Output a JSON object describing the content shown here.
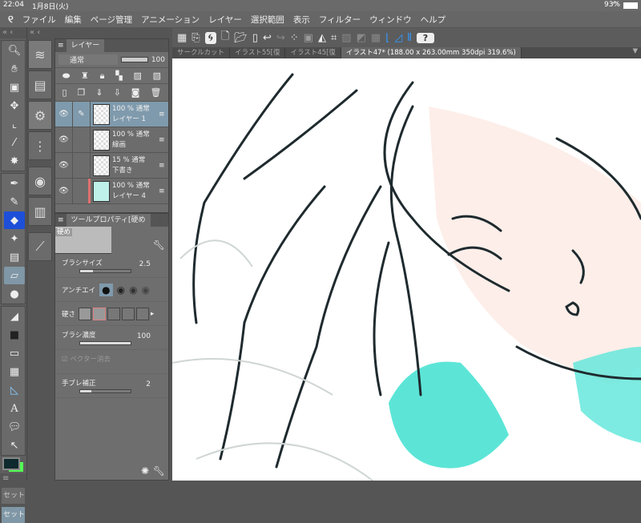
{
  "status": {
    "time": "22:04",
    "date": "1月8日(火)",
    "battery": "93%"
  },
  "menu": [
    "ファイル",
    "編集",
    "ページ管理",
    "アニメーション",
    "レイヤー",
    "選択範囲",
    "表示",
    "フィルター",
    "ウィンドウ",
    "ヘルプ"
  ],
  "layer_panel": {
    "tab": "レイヤー",
    "blend_mode": "通常",
    "opacity": "100",
    "layers": [
      {
        "line1": "100 % 通常",
        "line2": "レイヤー 1",
        "selected": true
      },
      {
        "line1": "100 % 通常",
        "line2": "線画"
      },
      {
        "line1": "15 % 通常",
        "line2": "下書き"
      },
      {
        "line1": "100 % 通常",
        "line2": "レイヤー 4"
      }
    ]
  },
  "tool_property": {
    "tab": "ツールプロパティ[硬め",
    "preset": "硬め",
    "brush_size_label": "ブラシサイズ",
    "brush_size": "2.5",
    "antialias_label": "アンチエイ",
    "hardness_label": "硬さ",
    "density_label": "ブラシ濃度",
    "density": "100",
    "vector_erase_label": "ベクター消去",
    "stabilization_label": "手ブレ補正",
    "stabilization": "2"
  },
  "set_buttons": [
    "セット",
    "セット"
  ],
  "tabs": [
    {
      "label": "サークルカット"
    },
    {
      "label": "イラスト55[復"
    },
    {
      "label": "イラスト45[復"
    },
    {
      "label": "イラスト47* (188.00 x 263.00mm 350dpi 319.6%)",
      "active": true
    }
  ],
  "colors": {
    "accent": "#7f9aac",
    "cyan": "#40e0d0"
  }
}
